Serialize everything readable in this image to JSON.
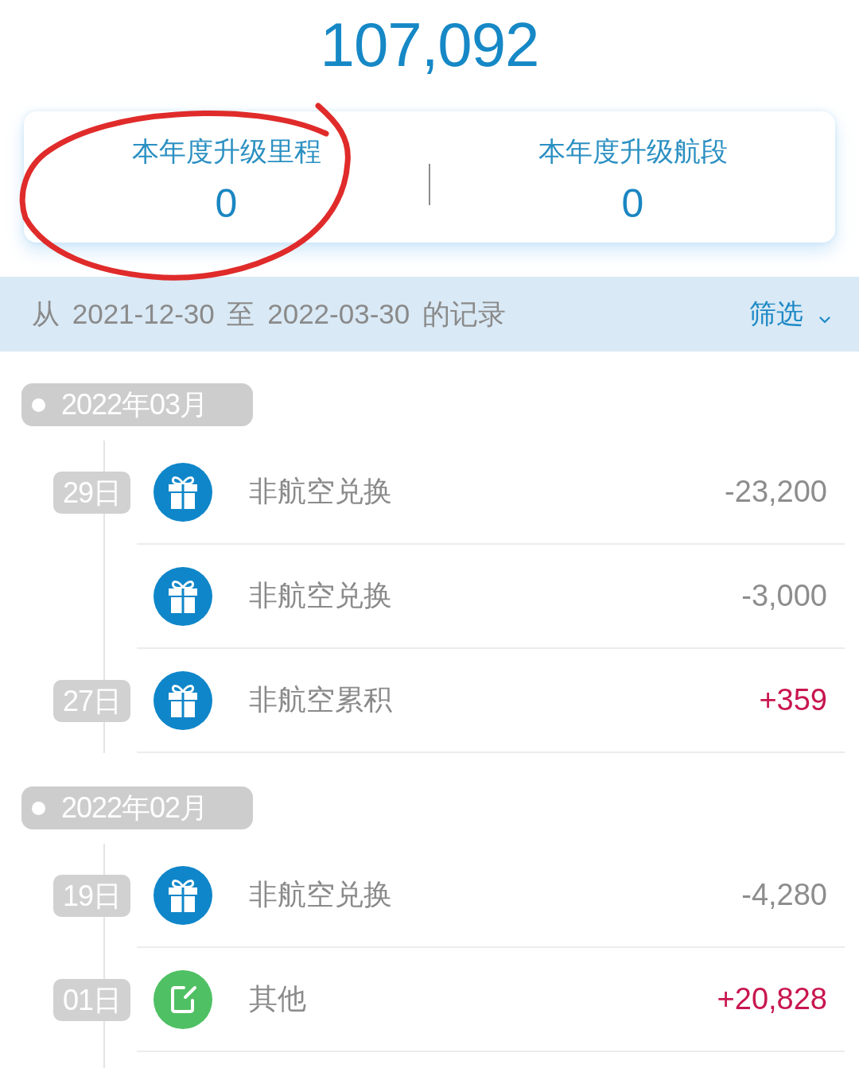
{
  "balance": "107,092",
  "stats": [
    {
      "label": "本年度升级里程",
      "value": "0",
      "circled": true
    },
    {
      "label": "本年度升级航段",
      "value": "0",
      "circled": false
    }
  ],
  "range_bar": {
    "text": "从 2021-12-30 至 2022-03-30 的记录",
    "filter": "筛选"
  },
  "months": [
    {
      "label": "2022年03月",
      "records": [
        {
          "day": "29日",
          "kind": "gift",
          "title": "非航空兑换",
          "amount": "-23,200",
          "credit": false
        },
        {
          "kind": "gift",
          "title": "非航空兑换",
          "amount": "-3,000",
          "credit": false
        },
        {
          "day": "27日",
          "kind": "gift",
          "title": "非航空累积",
          "amount": "+359",
          "credit": true
        }
      ]
    },
    {
      "label": "2022年02月",
      "records": [
        {
          "day": "19日",
          "kind": "gift",
          "title": "非航空兑换",
          "amount": "-4,280",
          "credit": false
        },
        {
          "day": "01日",
          "kind": "note",
          "title": "其他",
          "amount": "+20,828",
          "credit": true
        }
      ]
    }
  ]
}
